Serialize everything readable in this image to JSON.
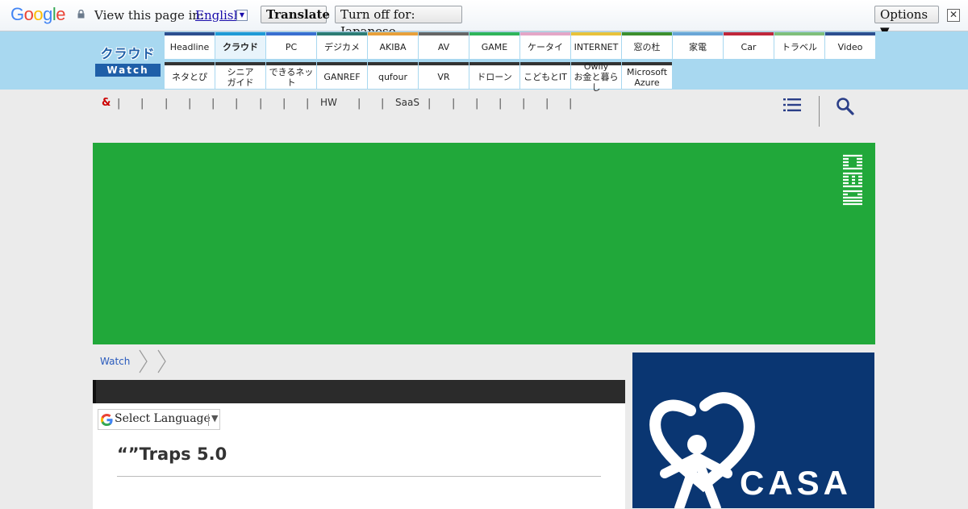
{
  "translate_bar": {
    "logo_letters": [
      "G",
      "o",
      "o",
      "g",
      "l",
      "e"
    ],
    "logo_colors": [
      "#4285f4",
      "#ea4335",
      "#fbbc05",
      "#4285f4",
      "#34a853",
      "#ea4335"
    ],
    "view_text": "View this page in:",
    "language": "English",
    "language_arrow": "▼",
    "translate_label": "Translate",
    "turn_off_label": "Turn off for: Japanese",
    "options_label": "Options ▼",
    "close_glyph": "✕"
  },
  "site": {
    "logo_top": "クラウド",
    "logo_bottom": "Watch",
    "nav_row1": [
      {
        "label": "Headline",
        "color": "#2c4f8f"
      },
      {
        "label": "クラウド",
        "color": "#1f9ad6",
        "active": true
      },
      {
        "label": "PC",
        "color": "#3a6fd0"
      },
      {
        "label": "デジカメ",
        "color": "#2d7c74"
      },
      {
        "label": "AKIBA",
        "color": "#e8a03a"
      },
      {
        "label": "AV",
        "color": "#666666"
      },
      {
        "label": "GAME",
        "color": "#2fb45a"
      },
      {
        "label": "ケータイ",
        "color": "#e4a6c6"
      },
      {
        "label": "INTERNET",
        "color": "#e8c23a"
      },
      {
        "label": "窓の杜",
        "color": "#3d8f2e"
      },
      {
        "label": "家電",
        "color": "#6aa6d6"
      },
      {
        "label": "Car",
        "color": "#c0273a"
      },
      {
        "label": "トラベル",
        "color": "#7fbf7a"
      },
      {
        "label": "Video",
        "color": "#2c4f8f"
      }
    ],
    "nav_row2": [
      {
        "label": "ネタとぴ"
      },
      {
        "label": "シニア\nガイド"
      },
      {
        "label": "できるネット"
      },
      {
        "label": "GANREF"
      },
      {
        "label": "qufour"
      },
      {
        "label": "VR"
      },
      {
        "label": "ドローン"
      },
      {
        "label": "こどもとIT"
      },
      {
        "label": "Owlly\nお金と暮らし"
      },
      {
        "label": "Microsoft\nAzure"
      }
    ]
  },
  "subnav": {
    "amp": "&",
    "separator": "|",
    "hw": "HW",
    "saas": "SaaS"
  },
  "breadcrumb": {
    "watch": "Watch"
  },
  "article": {
    "select_language": "Select Language",
    "select_arrow": "▼",
    "title": "“”Traps 5.0"
  },
  "side_ad": {
    "brand": "CASA",
    "reg": "®"
  }
}
